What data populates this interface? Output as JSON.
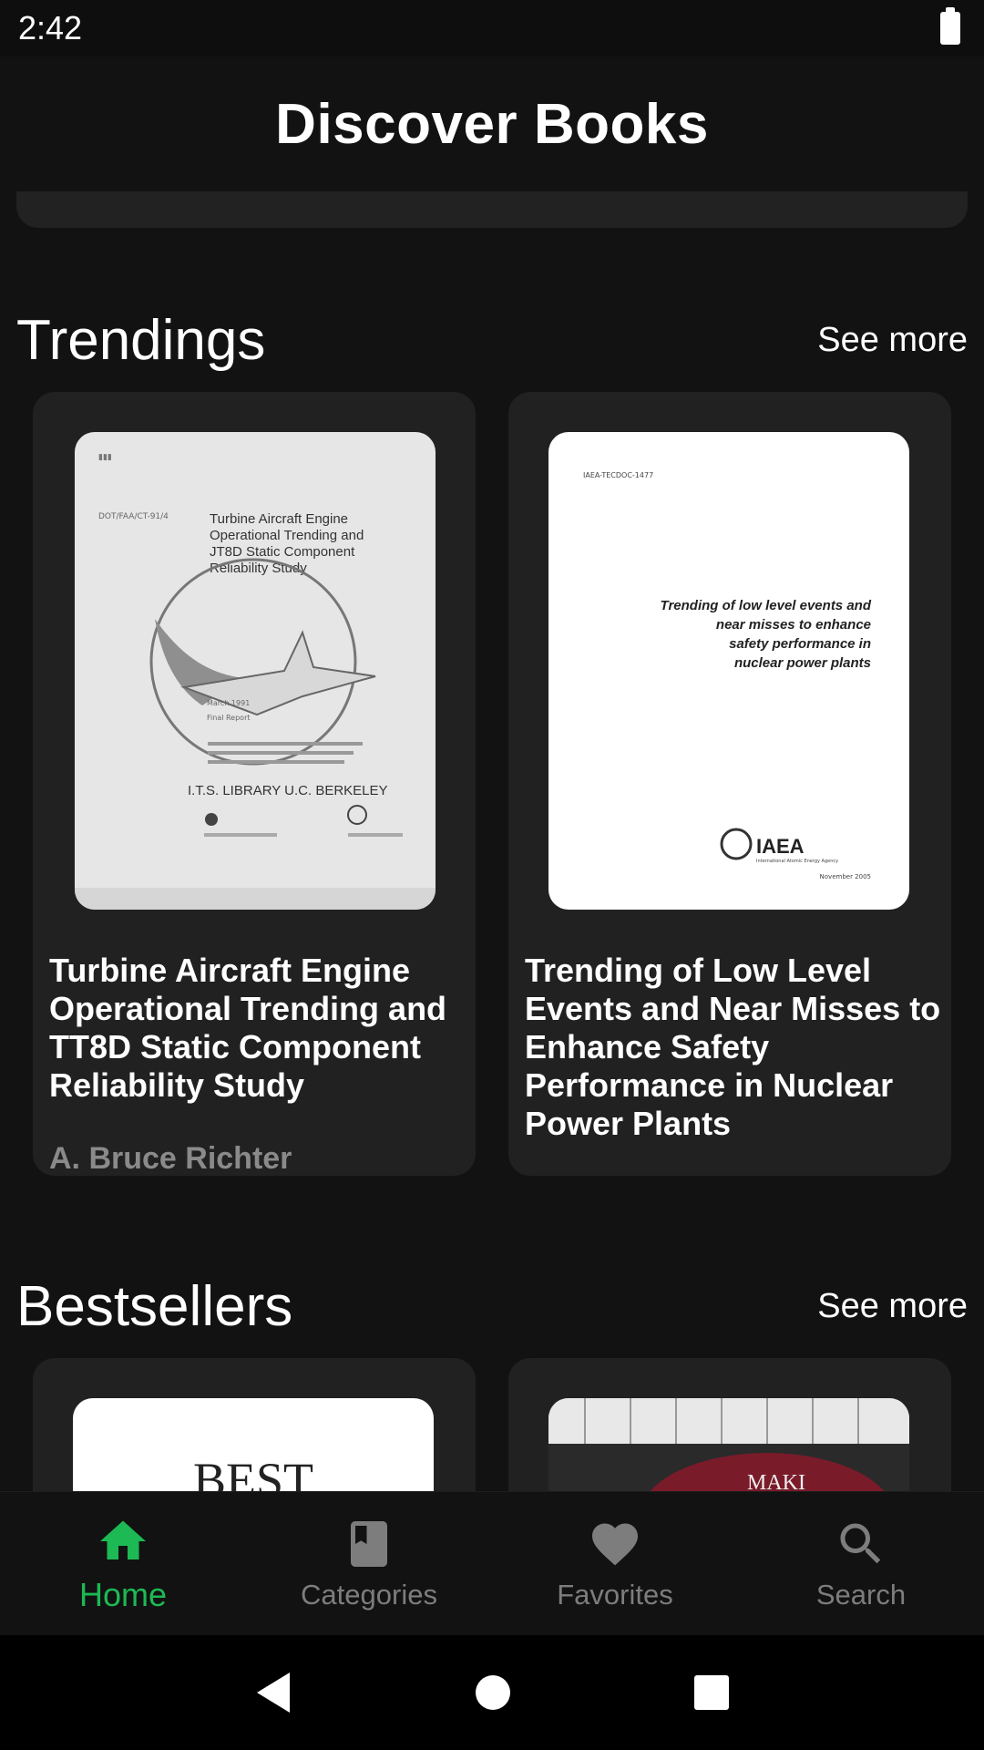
{
  "status_bar": {
    "time": "2:42"
  },
  "app_bar": {
    "title": "Discover Books"
  },
  "sections": {
    "trendings": {
      "title": "Trendings",
      "see_more": "See more",
      "books": [
        {
          "title": "Turbine Aircraft Engine Operational Trending and TT8D Static Component Reliability Study",
          "author": "A. Bruce Richter",
          "cover_text": {
            "title_lines": [
              "Turbine Aircraft Engine",
              "Operational Trending and",
              "JT8D Static Component",
              "Reliability Study"
            ],
            "library": "I.T.S. LIBRARY U.C. BERKELEY"
          }
        },
        {
          "title": "Trending of Low Level Events and Near Misses to Enhance Safety Performance in Nuclear Power Plants",
          "author": "",
          "cover_text": {
            "doc_id": "IAEA-TECDOC-1477",
            "title_lines": [
              "Trending of low level events and",
              "near misses to enhance",
              "safety performance in",
              "nuclear power plants"
            ],
            "publisher": "IAEA",
            "publisher_sub": "International Atomic Energy Agency",
            "date": "November 2005"
          }
        }
      ]
    },
    "bestsellers": {
      "title": "Bestsellers",
      "see_more": "See more",
      "books": [
        {
          "cover_text": "BEST"
        },
        {
          "cover_text": "MAKI"
        }
      ]
    }
  },
  "bottom_nav": {
    "items": [
      {
        "label": "Home",
        "icon": "home-icon",
        "active": true
      },
      {
        "label": "Categories",
        "icon": "book-icon",
        "active": false
      },
      {
        "label": "Favorites",
        "icon": "heart-icon",
        "active": false
      },
      {
        "label": "Search",
        "icon": "search-icon",
        "active": false
      }
    ]
  },
  "colors": {
    "background": "#121212",
    "card": "#212121",
    "accent": "#1db954",
    "inactive": "#7d7d7d"
  }
}
